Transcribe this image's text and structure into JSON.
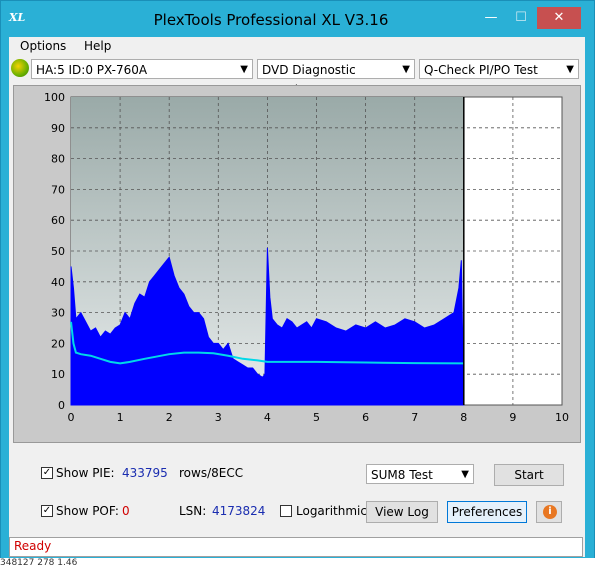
{
  "window": {
    "title": "PlexTools Professional XL V3.16",
    "icon_text": "XL",
    "controls": {
      "minimize": "—",
      "maximize": "☐",
      "close": "✕"
    }
  },
  "menu": {
    "items": [
      "Options",
      "Help"
    ]
  },
  "toolbar": {
    "drive": "HA:5 ID:0  PX-760A",
    "function": "DVD Diagnostic Functions",
    "test": "Q-Check PI/PO Test"
  },
  "chart_data": {
    "type": "area",
    "xlim": [
      0,
      10
    ],
    "ylim": [
      0,
      100
    ],
    "x_ticks": [
      "0",
      "1",
      "2",
      "3",
      "4",
      "5",
      "6",
      "7",
      "8",
      "9",
      "10"
    ],
    "y_ticks": [
      "0",
      "10",
      "20",
      "30",
      "40",
      "50",
      "60",
      "70",
      "80",
      "90",
      "100"
    ],
    "grid": true,
    "end_marker_x": 8,
    "series": [
      {
        "kind": "bars",
        "color": "#0000ff",
        "x": [
          0.0,
          0.05,
          0.1,
          0.2,
          0.3,
          0.4,
          0.5,
          0.6,
          0.7,
          0.8,
          0.9,
          1.0,
          1.1,
          1.2,
          1.3,
          1.4,
          1.5,
          1.6,
          1.7,
          1.8,
          1.9,
          2.0,
          2.1,
          2.2,
          2.3,
          2.4,
          2.5,
          2.6,
          2.7,
          2.8,
          2.9,
          3.0,
          3.1,
          3.2,
          3.3,
          3.4,
          3.5,
          3.6,
          3.7,
          3.8,
          3.9,
          3.95,
          4.0,
          4.05,
          4.1,
          4.2,
          4.3,
          4.4,
          4.5,
          4.6,
          4.7,
          4.8,
          4.9,
          5.0,
          5.2,
          5.4,
          5.6,
          5.8,
          6.0,
          6.2,
          6.4,
          6.6,
          6.8,
          7.0,
          7.2,
          7.4,
          7.6,
          7.8,
          7.9,
          7.95,
          8.0
        ],
        "y": [
          45,
          38,
          28,
          30,
          27,
          24,
          25,
          22,
          24,
          23,
          25,
          26,
          30,
          28,
          33,
          36,
          35,
          40,
          42,
          44,
          46,
          48,
          42,
          38,
          36,
          32,
          30,
          30,
          28,
          22,
          20,
          20,
          18,
          20,
          15,
          14,
          13,
          12,
          12,
          10,
          9,
          10,
          51,
          35,
          28,
          26,
          25,
          28,
          27,
          25,
          26,
          27,
          25,
          28,
          27,
          25,
          24,
          26,
          25,
          27,
          25,
          26,
          28,
          27,
          25,
          26,
          28,
          30,
          38,
          47,
          0
        ]
      },
      {
        "kind": "line",
        "color": "#00d8e8",
        "x": [
          0.0,
          0.05,
          0.1,
          0.2,
          0.4,
          0.6,
          0.8,
          1.0,
          1.2,
          1.5,
          2.0,
          2.3,
          2.6,
          2.9,
          3.2,
          3.5,
          3.8,
          4.0,
          5.0,
          6.0,
          7.0,
          8.0
        ],
        "y": [
          27,
          20,
          17,
          16.5,
          16,
          15,
          14,
          13.5,
          14,
          15,
          16.5,
          17,
          17,
          16.8,
          16,
          15,
          14.5,
          14,
          14,
          13.8,
          13.6,
          13.5
        ]
      }
    ]
  },
  "bottom": {
    "show_pie_label": "Show PIE:",
    "pie_value": "433795",
    "pie_unit": "rows/8ECC",
    "show_pof_label": "Show POF:",
    "pof_value": "0",
    "lsn_label": "LSN:",
    "lsn_value": "4173824",
    "logarithmic_label": "Logarithmic",
    "sum_select": "SUM8 Test",
    "start_button": "Start",
    "view_log_button": "View Log",
    "preferences_button": "Preferences"
  },
  "status": {
    "text": "Ready"
  },
  "background_text": "348127    278    1.46"
}
